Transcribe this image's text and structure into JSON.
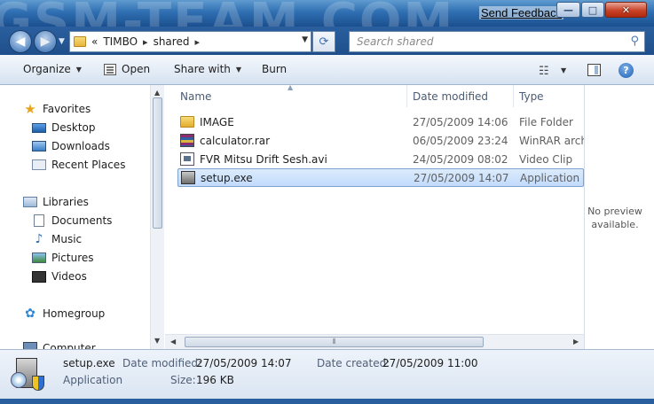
{
  "titlebar": {
    "watermark": "GSM-TEAM.COM",
    "send_feedback": "Send Feedback",
    "min_glyph": "—",
    "max_glyph": "□",
    "close_glyph": "✕"
  },
  "address": {
    "overflow": "«",
    "crumbs": [
      "TIMBO",
      "shared"
    ],
    "separator": "▸",
    "search_placeholder": "Search shared"
  },
  "toolbar": {
    "organize": "Organize",
    "open": "Open",
    "share_with": "Share with",
    "burn": "Burn"
  },
  "nav": {
    "favorites": "Favorites",
    "desktop": "Desktop",
    "downloads": "Downloads",
    "recent_places": "Recent Places",
    "libraries": "Libraries",
    "documents": "Documents",
    "music": "Music",
    "pictures": "Pictures",
    "videos": "Videos",
    "homegroup": "Homegroup",
    "computer_partial": "Computer"
  },
  "columns": {
    "name": "Name",
    "date_modified": "Date modified",
    "type": "Type"
  },
  "files": [
    {
      "name": "IMAGE",
      "date": "27/05/2009 14:06",
      "type": "File Folder",
      "icon": "folder-icon"
    },
    {
      "name": "calculator.rar",
      "date": "06/05/2009 23:24",
      "type": "WinRAR archi",
      "icon": "winrar-icon"
    },
    {
      "name": "FVR Mitsu Drift Sesh.avi",
      "date": "24/05/2009 08:02",
      "type": "Video Clip",
      "icon": "video-icon"
    },
    {
      "name": "setup.exe",
      "date": "27/05/2009 14:07",
      "type": "Application",
      "icon": "setup-icon",
      "selected": true
    }
  ],
  "preview": {
    "line1": "No preview",
    "line2": "available."
  },
  "details": {
    "filename": "setup.exe",
    "filetype": "Application",
    "date_modified_label": "Date modified:",
    "date_modified_value": "27/05/2009 14:07",
    "date_created_label": "Date created:",
    "date_created_value": "27/05/2009 11:00",
    "size_label": "Size:",
    "size_value": "196 KB"
  },
  "colors": {
    "titlebar": "#2f6fb2",
    "selection": "#c1dbfc",
    "close_button": "#c94329"
  }
}
